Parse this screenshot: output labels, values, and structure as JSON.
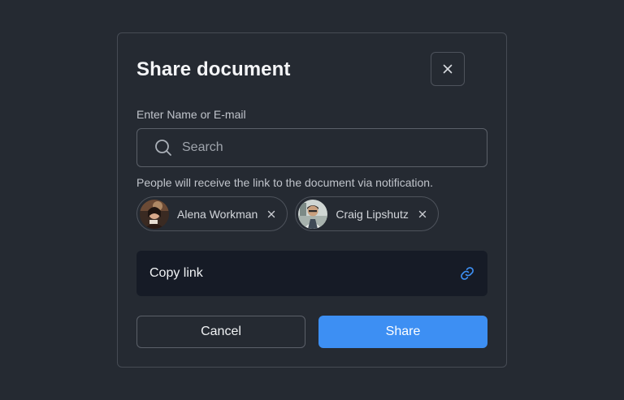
{
  "dialog": {
    "title": "Share document",
    "field_label": "Enter Name or E-mail",
    "search_placeholder": "Search",
    "search_value": "",
    "hint": "People will receive the link to the document via notification.",
    "recipients": [
      {
        "name": "Alena Workman",
        "avatar": "photo-avatar"
      },
      {
        "name": "Craig Lipshutz",
        "avatar": "photo-avatar"
      }
    ],
    "copy_link_label": "Copy link",
    "cancel_label": "Cancel",
    "share_label": "Share"
  },
  "icons": {
    "close": "close-icon",
    "search": "search-icon",
    "remove": "close-icon",
    "link": "link-icon"
  },
  "colors": {
    "background": "#252a32",
    "border": "#464b54",
    "copy_link_bg": "#161b26",
    "accent": "#3d8ff3"
  }
}
